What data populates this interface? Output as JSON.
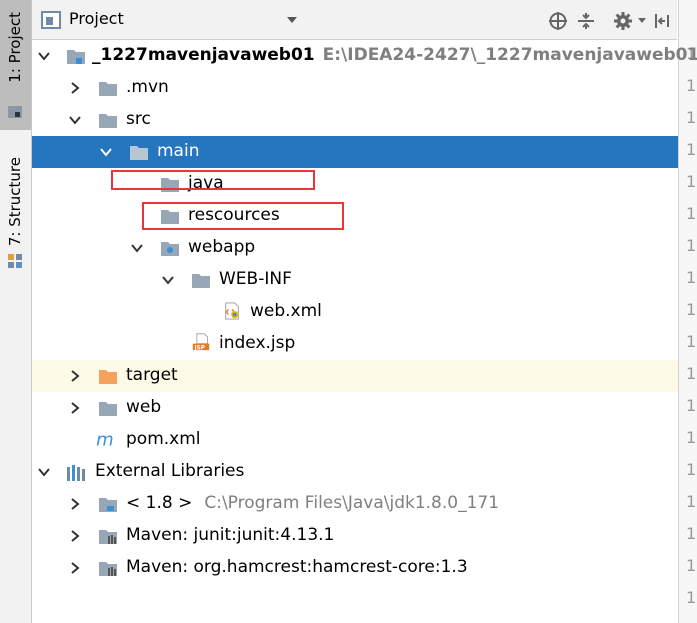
{
  "tool_strip": {
    "project_tab": "1: Project",
    "structure_tab": "7: Structure"
  },
  "header": {
    "title": "Project",
    "icons": [
      "locate-icon",
      "collapse-all-icon",
      "gear-icon",
      "hide-icon"
    ]
  },
  "tree": {
    "root": {
      "name": "_1227mavenjavaweb01",
      "path": "E:\\IDEA24-2427\\_1227mavenjavaweb01"
    },
    "mvn": ".mvn",
    "src": "src",
    "main": "main",
    "java": "java",
    "resources": "rescources",
    "webapp": "webapp",
    "webinf": "WEB-INF",
    "webxml": "web.xml",
    "indexjsp": "index.jsp",
    "target": "target",
    "web": "web",
    "pom": "pom.xml",
    "external_libraries": "External Libraries",
    "jdk": {
      "name": "< 1.8 >",
      "path": "C:\\Program Files\\Java\\jdk1.8.0_171"
    },
    "junit": "Maven: junit:junit:4.13.1",
    "hamcrest": "Maven: org.hamcrest:hamcrest-core:1.3"
  },
  "gutter": {
    "line_digit": "1"
  },
  "colors": {
    "selection": "#2675bf",
    "folder": "#97a7b5",
    "excluded_folder": "#f5a35c",
    "highlight_box": "#e8353a"
  }
}
